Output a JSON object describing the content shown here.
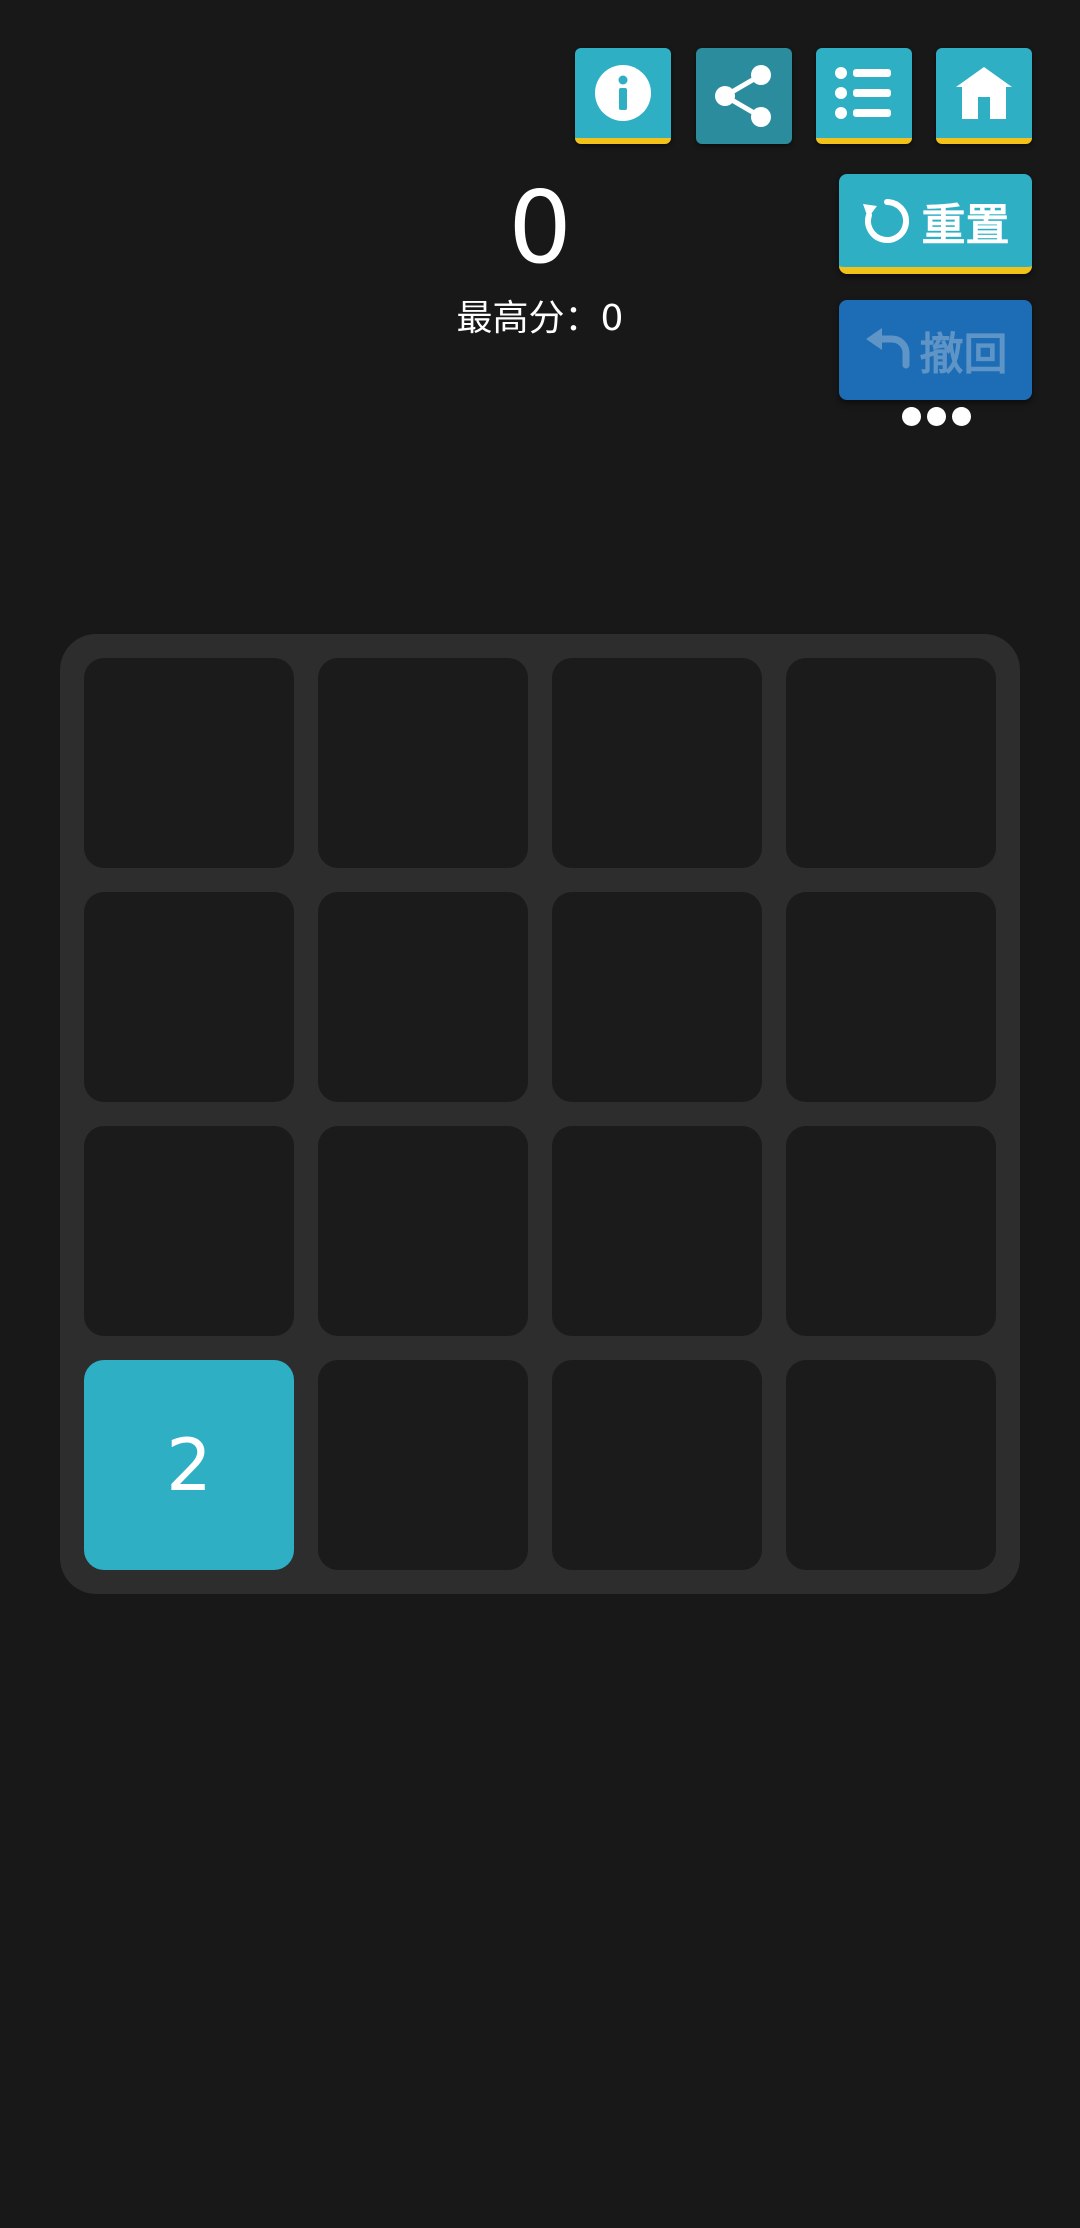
{
  "toolbar": {
    "icons": [
      "info-icon",
      "share-icon",
      "list-icon",
      "home-icon"
    ]
  },
  "score": {
    "current": "0",
    "best_label": "最高分：0"
  },
  "actions": {
    "reset_label": "重置",
    "undo_label": "撤回"
  },
  "board": {
    "size": 4,
    "tiles": [
      [
        "",
        "",
        "",
        ""
      ],
      [
        "",
        "",
        "",
        ""
      ],
      [
        "",
        "",
        "",
        ""
      ],
      [
        "2",
        "",
        "",
        ""
      ]
    ]
  },
  "colors": {
    "background": "#181818",
    "board": "#2d2d2d",
    "empty_cell": "#1b1b1b",
    "tile_2": "#2eafc4",
    "accent_gold": "#f2c21b",
    "undo_button": "#1c6db6"
  }
}
